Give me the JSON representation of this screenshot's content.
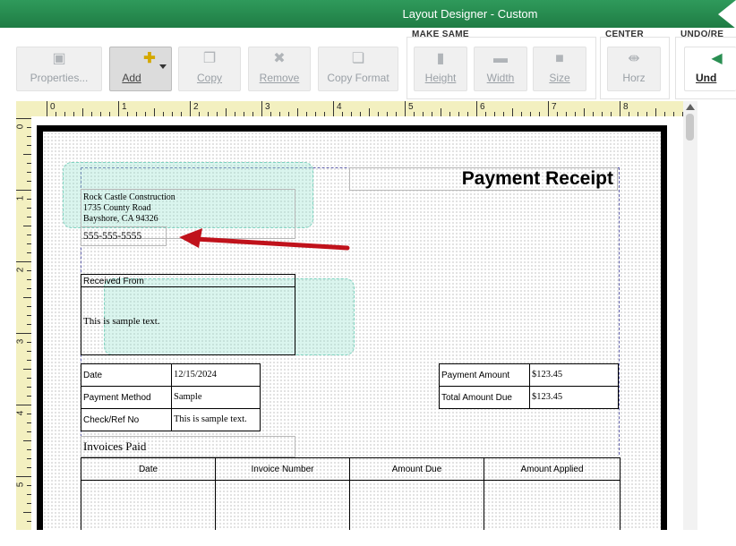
{
  "window": {
    "title": "Layout Designer - Custom"
  },
  "toolbar": {
    "properties": "Properties...",
    "add": "Add",
    "copy": "Copy",
    "remove": "Remove",
    "copy_format": "Copy Format",
    "make_same_label": "MAKE SAME",
    "height": "Height",
    "width": "Width",
    "size": "Size",
    "center_label": "CENTER",
    "horz": "Horz",
    "undo_label": "UNDO/RE",
    "undo": "Und"
  },
  "rulers": {
    "h": [
      "0",
      "1",
      "2",
      "3",
      "4",
      "5",
      "6",
      "7",
      "8"
    ],
    "v": [
      "0",
      "1",
      "2",
      "3",
      "4",
      "5"
    ]
  },
  "form": {
    "title": "Payment Receipt",
    "company": {
      "name": "Rock Castle Construction",
      "address1": "1735 County Road",
      "address2": "Bayshore, CA 94326",
      "phone": "555-555-5555"
    },
    "received_from": {
      "label": "Received From",
      "value": "This is sample text."
    },
    "date": {
      "label": "Date",
      "value": "12/15/2024"
    },
    "payment_method": {
      "label": "Payment Method",
      "value": "Sample"
    },
    "check_ref": {
      "label": "Check/Ref No",
      "value": "This is sample text."
    },
    "payment_amount": {
      "label": "Payment Amount",
      "value": "$123.45"
    },
    "total_amount_due": {
      "label": "Total Amount Due",
      "value": "$123.45"
    },
    "invoices_paid": {
      "title": "Invoices Paid",
      "columns": [
        "Date",
        "Invoice Number",
        "Amount Due",
        "Amount Applied"
      ]
    }
  },
  "colors": {
    "titlebar": "#2a8f52",
    "arrow": "#c0121b",
    "ruler": "#f3f0c0",
    "highlight": "#96e1cd"
  }
}
